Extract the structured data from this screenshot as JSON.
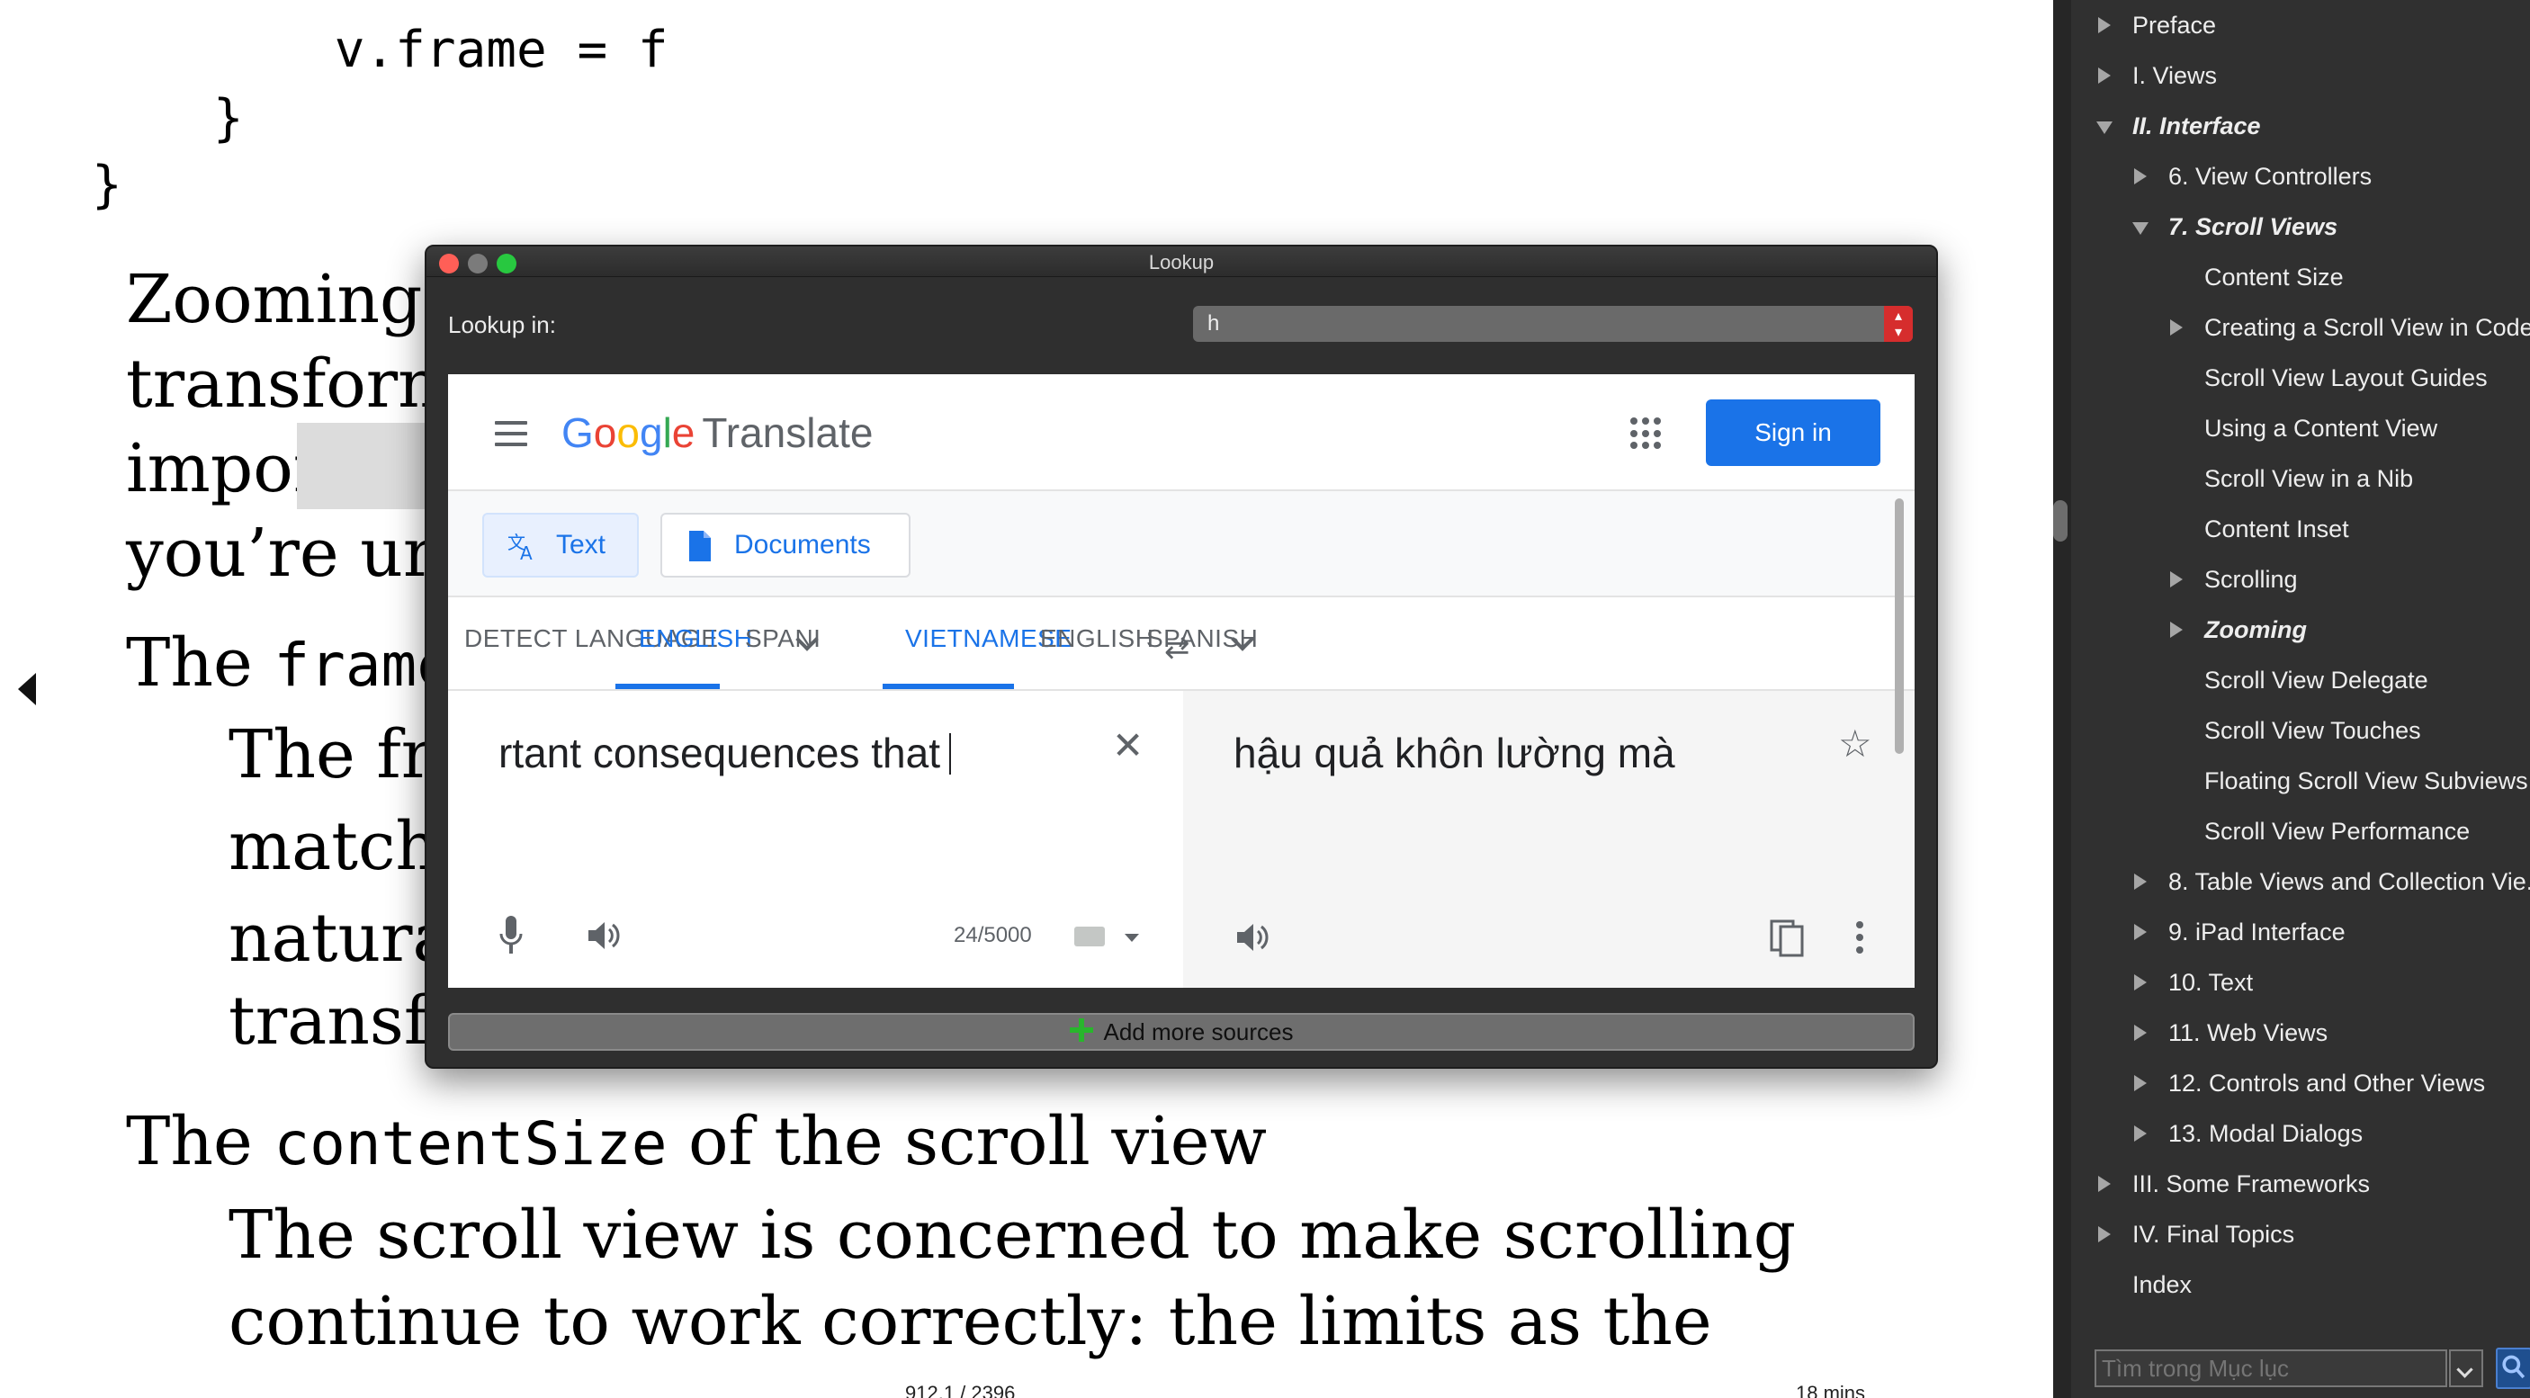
{
  "reader": {
    "code_lines": [
      "        v.frame = f",
      "    }",
      "}"
    ],
    "para1_lines": [
      "Zooming",
      "transforn",
      "importan",
      "you’re ur"
    ],
    "frame_line": {
      "pre": "The ",
      "code": "frame"
    },
    "indent_lines": [
      "The fr",
      "match",
      "natura",
      "transf"
    ],
    "content_size_line": {
      "pre": "The ",
      "code": "contentSize",
      "post": " of the scroll view"
    },
    "scroll_lines": [
      "The scroll view is concerned to make scrolling",
      "continue to work correctly: the limits as the"
    ],
    "footer": {
      "page": "912.1 / 2396",
      "time": "18 mins"
    }
  },
  "lookup": {
    "title": "Lookup",
    "lookup_in_label": "Lookup in:",
    "source_value": "h",
    "add_sources_label": "Add more sources",
    "translate": {
      "logo_google": [
        "G",
        "o",
        "o",
        "g",
        "l",
        "e"
      ],
      "logo_suffix": "Translate",
      "sign_in": "Sign in",
      "modes": {
        "text": "Text",
        "documents": "Documents"
      },
      "source_langs": [
        "DETECT LANGUAGE",
        "ENGLISH",
        "SPANI"
      ],
      "target_langs": [
        "VIETNAMESE",
        "ENGLISH",
        "SPANISH"
      ],
      "source_text": "rtant consequences that",
      "char_count": "24/5000",
      "target_text": "hậu quả khôn lường mà"
    }
  },
  "toc": {
    "items": [
      {
        "label": "Preface",
        "arrow": "right"
      },
      {
        "label": "I. Views",
        "arrow": "right"
      },
      {
        "label": "II. Interface",
        "arrow": "down"
      },
      {
        "label": "6. View Controllers",
        "arrow": "right"
      },
      {
        "label": "7. Scroll Views",
        "arrow": "down"
      },
      {
        "label": "Content Size",
        "arrow": "none"
      },
      {
        "label": "Creating a Scroll View in Code",
        "arrow": "right"
      },
      {
        "label": "Scroll View Layout Guides",
        "arrow": "none"
      },
      {
        "label": "Using a Content View",
        "arrow": "none"
      },
      {
        "label": "Scroll View in a Nib",
        "arrow": "none"
      },
      {
        "label": "Content Inset",
        "arrow": "none"
      },
      {
        "label": "Scrolling",
        "arrow": "right"
      },
      {
        "label": "Zooming",
        "arrow": "right"
      },
      {
        "label": "Scroll View Delegate",
        "arrow": "none"
      },
      {
        "label": "Scroll View Touches",
        "arrow": "none"
      },
      {
        "label": "Floating Scroll View Subviews",
        "arrow": "none"
      },
      {
        "label": "Scroll View Performance",
        "arrow": "none"
      },
      {
        "label": "8. Table Views and Collection Vie...",
        "arrow": "right"
      },
      {
        "label": "9. iPad Interface",
        "arrow": "right"
      },
      {
        "label": "10. Text",
        "arrow": "right"
      },
      {
        "label": "11. Web Views",
        "arrow": "right"
      },
      {
        "label": "12. Controls and Other Views",
        "arrow": "right"
      },
      {
        "label": "13. Modal Dialogs",
        "arrow": "right"
      },
      {
        "label": "III. Some Frameworks",
        "arrow": "right"
      },
      {
        "label": "IV. Final Topics",
        "arrow": "right"
      },
      {
        "label": "Index",
        "arrow": "none"
      }
    ],
    "search_placeholder": "Tìm trong Mục lục"
  },
  "colors": {
    "accent_blue": "#1a73e8",
    "toc_background": "#303030",
    "lookup_background": "#2f2f2f",
    "close_red": "#ff5f57",
    "zoom_green": "#28c840",
    "add_green": "#28b62c"
  },
  "icons": [
    "menu-icon",
    "apps-icon",
    "translate-icon",
    "document-icon",
    "swap-icon",
    "clear-icon",
    "mic-icon",
    "speaker-icon",
    "keyboard-icon",
    "star-icon",
    "copy-icon",
    "more-vert-icon",
    "search-icon",
    "plus-icon"
  ]
}
